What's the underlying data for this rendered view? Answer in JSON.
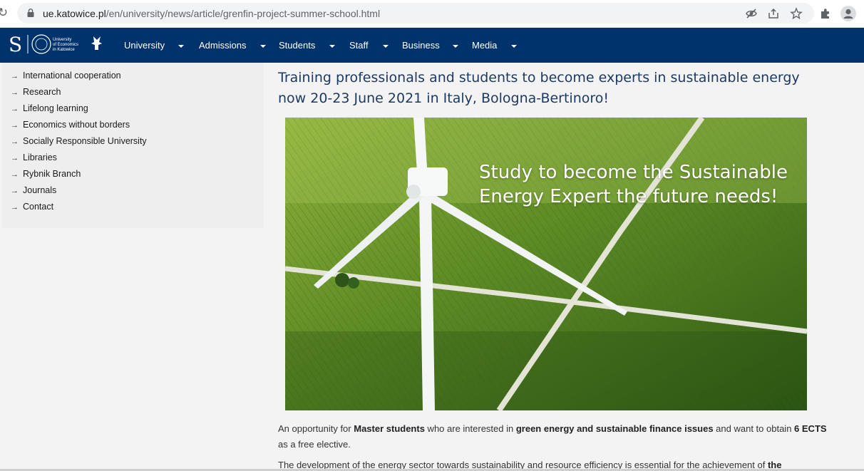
{
  "browser": {
    "url_host": "ue.katowice.pl",
    "url_path": "/en/university/news/article/grenfin-project-summer-school.html",
    "icons": [
      "reload-icon",
      "lock-icon",
      "eye-off-icon",
      "share-icon",
      "star-icon",
      "puzzle-icon",
      "profile-icon"
    ]
  },
  "nav": {
    "logo_lines": [
      "University",
      "of Economics",
      "in Katowice"
    ],
    "items": [
      {
        "label": "University"
      },
      {
        "label": "Admissions"
      },
      {
        "label": "Students"
      },
      {
        "label": "Staff"
      },
      {
        "label": "Business"
      },
      {
        "label": "Media"
      }
    ]
  },
  "sidebar": {
    "items": [
      {
        "label": "International cooperation"
      },
      {
        "label": "Research"
      },
      {
        "label": "Lifelong learning"
      },
      {
        "label": "Economics without borders"
      },
      {
        "label": "Socially Responsible University"
      },
      {
        "label": "Libraries"
      },
      {
        "label": "Rybnik Branch"
      },
      {
        "label": "Journals"
      },
      {
        "label": "Contact"
      }
    ]
  },
  "article": {
    "headline": "Training professionals and students to become experts in sustainable energy now 20-23 June 2021 in Italy, Bologna-Bertinoro!",
    "hero_caption": "Study to become the Sustainable Energy Expert the future needs!",
    "p1": {
      "t1": "An opportunity for ",
      "b1": "Master students",
      "t2": " who are interested in ",
      "b2": "green energy and sustainable finance issues",
      "t3": " and want to obtain ",
      "b3": "6 ECTS",
      "t4": " as a free elective."
    },
    "p2": {
      "t1": "The development of the energy sector towards sustainability and resource efficiency is essential for the achievement of ",
      "b1": "the"
    }
  }
}
